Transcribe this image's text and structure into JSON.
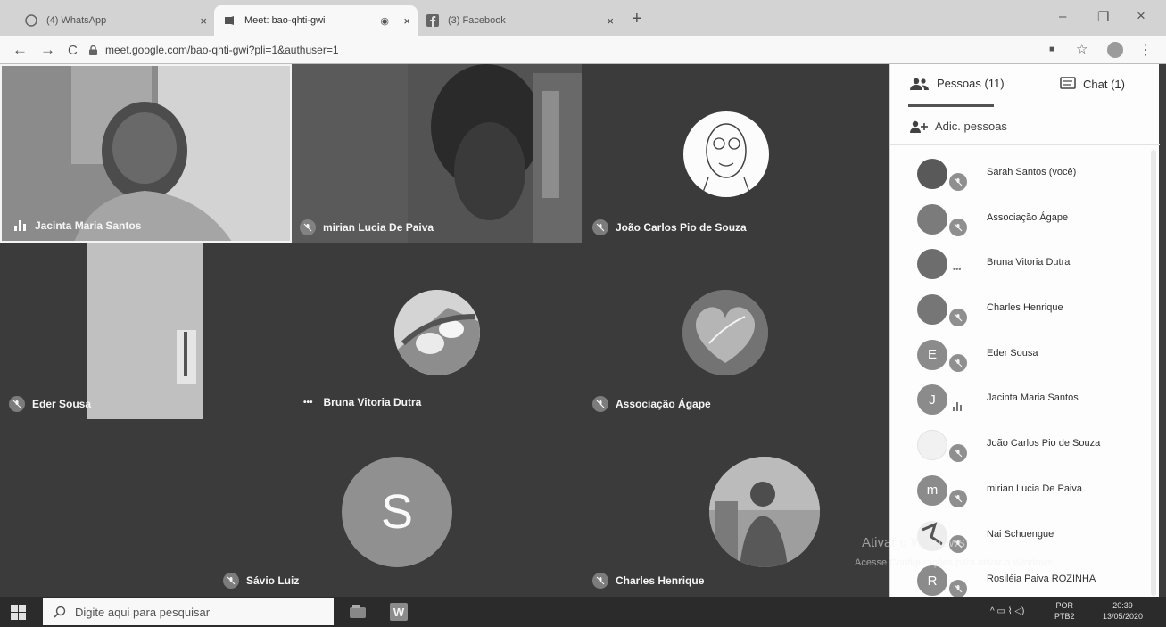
{
  "browser": {
    "tabs": [
      {
        "title": "(4) WhatsApp",
        "close": "×"
      },
      {
        "title": "Meet: bao-qhti-gwi",
        "close": "×"
      },
      {
        "title": "(3) Facebook",
        "close": "×"
      }
    ],
    "new_tab": "+",
    "window_controls": {
      "minimize": "–",
      "maximize": "❐",
      "close": "×"
    },
    "nav": {
      "back": "←",
      "forward": "→",
      "reload": "C"
    },
    "url": "meet.google.com/bao-qhti-gwi?pli=1&authuser=1",
    "actions": {
      "camera": "■",
      "star": "☆",
      "menu": "⋮"
    }
  },
  "meeting": {
    "tiles": [
      {
        "name": "Jacinta Maria Santos"
      },
      {
        "name": "mirian Lucia De Paiva"
      },
      {
        "name": "João Carlos Pio de Souza"
      },
      {
        "name": "Eder Sousa"
      },
      {
        "name": "Bruna Vitoria Dutra",
        "indicator": "•••"
      },
      {
        "name": "Associação Ágape"
      },
      {
        "name": "Sávio Luiz",
        "initial": "S"
      },
      {
        "name": "Charles Henrique"
      }
    ]
  },
  "panel": {
    "people_tab": "Pessoas (11)",
    "chat_tab": "Chat (1)",
    "add_people": "Adic. pessoas",
    "participants": [
      {
        "name": "Sarah Santos (você)",
        "initial": "",
        "status": "muted"
      },
      {
        "name": "Associação Ágape",
        "initial": "",
        "status": "muted"
      },
      {
        "name": "Bruna Vitoria Dutra",
        "initial": "",
        "status": "•••"
      },
      {
        "name": "Charles Henrique",
        "initial": "",
        "status": "muted"
      },
      {
        "name": "Eder Sousa",
        "initial": "E",
        "status": "muted"
      },
      {
        "name": "Jacinta Maria Santos",
        "initial": "J",
        "status": "speaking"
      },
      {
        "name": "João Carlos Pio de Souza",
        "initial": "",
        "status": "muted"
      },
      {
        "name": "mirian Lucia De Paiva",
        "initial": "m",
        "status": "muted"
      },
      {
        "name": "Nai Schuengue",
        "initial": "",
        "status": "muted"
      },
      {
        "name": "Rosiléia Paiva ROZINHA",
        "initial": "R",
        "status": "muted"
      }
    ]
  },
  "watermark": {
    "title": "Ativar o Windows",
    "subtitle": "Acesse Configurações para ativar o Windows."
  },
  "taskbar": {
    "search_placeholder": "Digite aqui para pesquisar",
    "lang_top": "POR",
    "lang_bottom": "PTB2",
    "time": "20:39",
    "date": "13/05/2020"
  }
}
